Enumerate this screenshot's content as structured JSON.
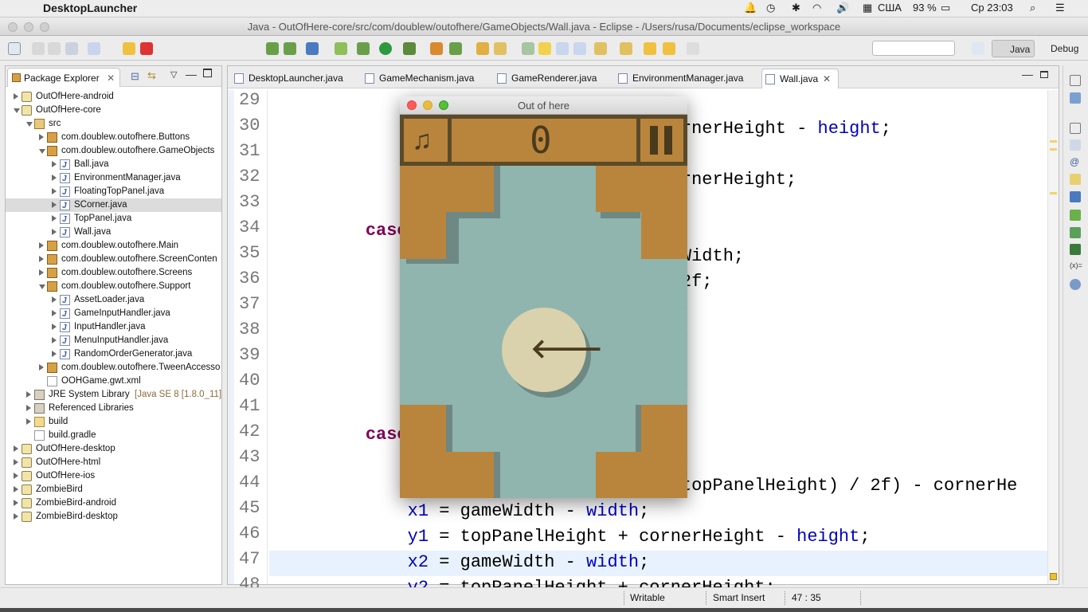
{
  "menubar": {
    "app_name": "DesktopLauncher",
    "input_source": "США",
    "battery": "93 %",
    "clock": "Ср 23:03"
  },
  "window": {
    "title": "Java - OutOfHere-core/src/com/doublew/outofhere/GameObjects/Wall.java - Eclipse - /Users/rusa/Documents/eclipse_workspace"
  },
  "toolbar": {
    "perspectives": [
      "Java",
      "Debug"
    ],
    "search_value": ""
  },
  "package_explorer": {
    "title": "Package Explorer",
    "items": [
      {
        "label": "OutOfHere-android",
        "depth": 0,
        "icon": "project",
        "state": "closed"
      },
      {
        "label": "OutOfHere-core",
        "depth": 0,
        "icon": "project",
        "state": "open"
      },
      {
        "label": "src",
        "depth": 1,
        "icon": "source-folder",
        "state": "open"
      },
      {
        "label": "com.doublew.outofhere.Buttons",
        "depth": 2,
        "icon": "package",
        "state": "closed"
      },
      {
        "label": "com.doublew.outofhere.GameObjects",
        "depth": 2,
        "icon": "package",
        "state": "open"
      },
      {
        "label": "Ball.java",
        "depth": 3,
        "icon": "java-file",
        "state": "closed"
      },
      {
        "label": "EnvironmentManager.java",
        "depth": 3,
        "icon": "java-file",
        "state": "closed"
      },
      {
        "label": "FloatingTopPanel.java",
        "depth": 3,
        "icon": "java-file",
        "state": "closed"
      },
      {
        "label": "SCorner.java",
        "depth": 3,
        "icon": "java-file",
        "state": "closed",
        "selected": true
      },
      {
        "label": "TopPanel.java",
        "depth": 3,
        "icon": "java-file",
        "state": "closed"
      },
      {
        "label": "Wall.java",
        "depth": 3,
        "icon": "java-file",
        "state": "closed"
      },
      {
        "label": "com.doublew.outofhere.Main",
        "depth": 2,
        "icon": "package",
        "state": "closed"
      },
      {
        "label": "com.doublew.outofhere.ScreenConten",
        "depth": 2,
        "icon": "package",
        "state": "closed"
      },
      {
        "label": "com.doublew.outofhere.Screens",
        "depth": 2,
        "icon": "package",
        "state": "closed"
      },
      {
        "label": "com.doublew.outofhere.Support",
        "depth": 2,
        "icon": "package",
        "state": "open"
      },
      {
        "label": "AssetLoader.java",
        "depth": 3,
        "icon": "java-file",
        "state": "closed"
      },
      {
        "label": "GameInputHandler.java",
        "depth": 3,
        "icon": "java-file",
        "state": "closed"
      },
      {
        "label": "InputHandler.java",
        "depth": 3,
        "icon": "java-file",
        "state": "closed"
      },
      {
        "label": "MenuInputHandler.java",
        "depth": 3,
        "icon": "java-file",
        "state": "closed"
      },
      {
        "label": "RandomOrderGenerator.java",
        "depth": 3,
        "icon": "java-file",
        "state": "closed"
      },
      {
        "label": "com.doublew.outofhere.TweenAccesso",
        "depth": 2,
        "icon": "package",
        "state": "closed"
      },
      {
        "label": "OOHGame.gwt.xml",
        "depth": 2,
        "icon": "file",
        "state": "none"
      },
      {
        "label": "JRE System Library",
        "suffix": "[Java SE 8 [1.8.0_11]",
        "depth": 1,
        "icon": "library",
        "state": "closed"
      },
      {
        "label": "Referenced Libraries",
        "depth": 1,
        "icon": "library",
        "state": "closed"
      },
      {
        "label": "build",
        "depth": 1,
        "icon": "folder",
        "state": "closed"
      },
      {
        "label": "build.gradle",
        "depth": 1,
        "icon": "file",
        "state": "none"
      },
      {
        "label": "OutOfHere-desktop",
        "depth": 0,
        "icon": "project",
        "state": "closed"
      },
      {
        "label": "OutOfHere-html",
        "depth": 0,
        "icon": "project",
        "state": "closed"
      },
      {
        "label": "OutOfHere-ios",
        "depth": 0,
        "icon": "project",
        "state": "closed"
      },
      {
        "label": "ZombieBird",
        "depth": 0,
        "icon": "project",
        "state": "closed"
      },
      {
        "label": "ZombieBird-android",
        "depth": 0,
        "icon": "project",
        "state": "closed"
      },
      {
        "label": "ZombieBird-desktop",
        "depth": 0,
        "icon": "project",
        "state": "closed"
      }
    ]
  },
  "editor": {
    "tabs": [
      {
        "label": "DesktopLauncher.java",
        "active": false
      },
      {
        "label": "GameMechanism.java",
        "active": false
      },
      {
        "label": "GameRenderer.java",
        "active": false
      },
      {
        "label": "EnvironmentManager.java",
        "active": false
      },
      {
        "label": "Wall.java",
        "active": true
      }
    ],
    "lines": [
      {
        "n": "29",
        "code": [
          {
            "t": "                 ",
            "c": ""
          }
        ]
      },
      {
        "n": "30",
        "code": [
          {
            "t": "                                       rnerHeight - ",
            "c": ""
          },
          {
            "t": "height",
            "c": "fld"
          },
          {
            "t": ";",
            "c": ""
          }
        ]
      },
      {
        "n": "31",
        "code": []
      },
      {
        "n": "32",
        "code": [
          {
            "t": "                                       rnerHeight;",
            "c": ""
          }
        ]
      },
      {
        "n": "33",
        "code": []
      },
      {
        "n": "34",
        "code": [
          {
            "t": "         ",
            "c": ""
          },
          {
            "t": "case",
            "c": "kw"
          }
        ]
      },
      {
        "n": "35",
        "code": [
          {
            "t": "                                       Width;",
            "c": ""
          }
        ]
      },
      {
        "n": "36",
        "code": [
          {
            "t": "                                       2f;",
            "c": ""
          }
        ]
      },
      {
        "n": "37",
        "code": [
          {
            "t": "                                       ;",
            "c": ""
          }
        ]
      },
      {
        "n": "38",
        "code": [
          {
            "t": "                                       ;",
            "c": ""
          }
        ]
      },
      {
        "n": "39",
        "code": []
      },
      {
        "n": "40",
        "code": [
          {
            "t": "                                       ;",
            "c": ""
          }
        ]
      },
      {
        "n": "41",
        "code": []
      },
      {
        "n": "42",
        "code": [
          {
            "t": "         ",
            "c": ""
          },
          {
            "t": "case",
            "c": "kw"
          }
        ]
      },
      {
        "n": "43",
        "code": [
          {
            "t": "                                       ;",
            "c": ""
          }
        ]
      },
      {
        "n": "44",
        "code": [
          {
            "t": "                                       topPanelHeight) / 2f) - cornerHe",
            "c": ""
          }
        ]
      },
      {
        "n": "45",
        "code": [
          {
            "t": "             ",
            "c": ""
          },
          {
            "t": "x1",
            "c": "fld"
          },
          {
            "t": " = gameWidth - ",
            "c": ""
          },
          {
            "t": "width",
            "c": "fld"
          },
          {
            "t": ";",
            "c": ""
          }
        ]
      },
      {
        "n": "46",
        "code": [
          {
            "t": "             ",
            "c": ""
          },
          {
            "t": "y1",
            "c": "fld"
          },
          {
            "t": " = topPanelHeight + cornerHeight - ",
            "c": ""
          },
          {
            "t": "height",
            "c": "fld"
          },
          {
            "t": ";",
            "c": ""
          }
        ]
      },
      {
        "n": "47",
        "code": [
          {
            "t": "             ",
            "c": ""
          },
          {
            "t": "x2",
            "c": "fld"
          },
          {
            "t": " = gameWidth - ",
            "c": ""
          },
          {
            "t": "width",
            "c": "fld"
          },
          {
            "t": ";",
            "c": ""
          }
        ],
        "highlight": true
      },
      {
        "n": "48",
        "code": [
          {
            "t": "             ",
            "c": ""
          },
          {
            "t": "y2",
            "c": "fld"
          },
          {
            "t": " = topPanelHeight + cornerHeight;",
            "c": ""
          }
        ]
      }
    ]
  },
  "game_window": {
    "title": "Out of here",
    "score": "0"
  },
  "statusbar": {
    "writable": "Writable",
    "insert_mode": "Smart Insert",
    "position": "47 : 35"
  },
  "colors": {
    "game_bg": "#8fb5ae",
    "game_wall": "#b9853c",
    "keyword": "#7f0055",
    "field": "#0000c0"
  }
}
